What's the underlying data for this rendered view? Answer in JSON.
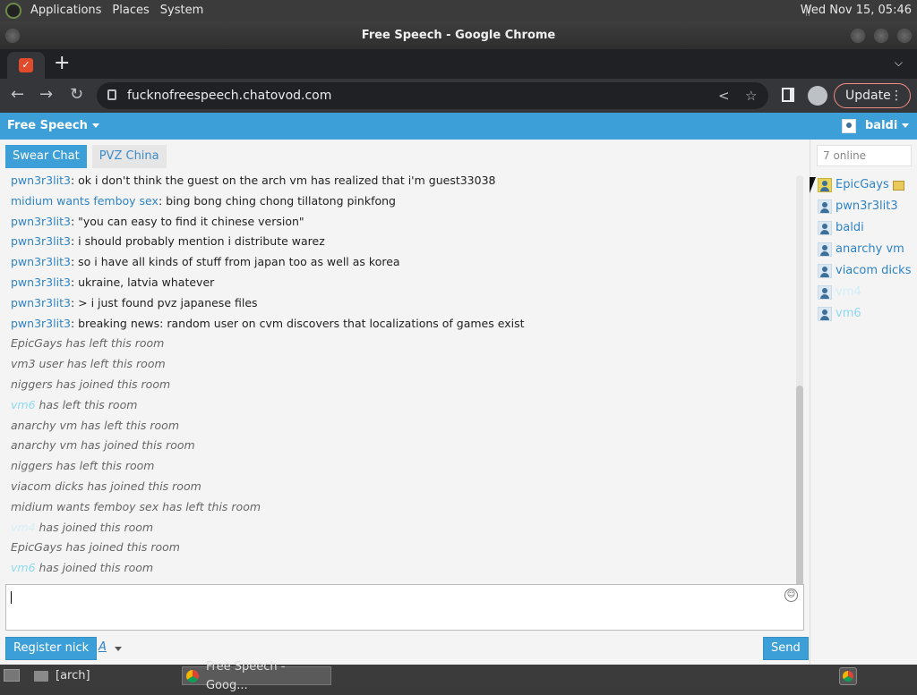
{
  "top_panel": {
    "menus": [
      "Applications",
      "Places",
      "System"
    ],
    "clock": "Wed Nov 15, 05:46"
  },
  "window": {
    "title": "Free Speech - Google Chrome"
  },
  "browser": {
    "url": "fucknofreespeech.chatovod.com",
    "update_label": "Update",
    "new_tab_label": "+"
  },
  "site": {
    "brand": "Free Speech",
    "username": "baldi",
    "room_tabs": [
      {
        "label": "Swear Chat",
        "active": true
      },
      {
        "label": "PVZ China",
        "active": false
      }
    ],
    "online_count": "7 online",
    "register_label": "Register nick",
    "font_label": "A",
    "send_label": "Send"
  },
  "messages": [
    {
      "type": "chat",
      "nick": "pwn3r3lit3",
      "text": ": ok i don't think the guest on the arch vm has realized that i'm guest33038"
    },
    {
      "type": "chat",
      "nick": "midium wants femboy sex",
      "text": ": bing bong ching chong tillatong pinkfong"
    },
    {
      "type": "chat",
      "nick": "pwn3r3lit3",
      "text": ": \"you can easy to find it chinese version\""
    },
    {
      "type": "chat",
      "nick": "pwn3r3lit3",
      "text": ": i should probably mention i distribute warez"
    },
    {
      "type": "chat",
      "nick": "pwn3r3lit3",
      "text": ": so i have all kinds of stuff from japan too as well as korea"
    },
    {
      "type": "chat",
      "nick": "pwn3r3lit3",
      "text": ": ukraine, latvia whatever"
    },
    {
      "type": "chat",
      "nick": "pwn3r3lit3",
      "text": ": > i just found pvz japanese files"
    },
    {
      "type": "chat",
      "nick": "pwn3r3lit3",
      "text": ": breaking news: random user on cvm discovers that localizations of games exist"
    },
    {
      "type": "event",
      "nick": "EpicGays",
      "text": " has left this room"
    },
    {
      "type": "event",
      "nick": "vm3 user",
      "text": " has left this room"
    },
    {
      "type": "event",
      "nick": "niggers",
      "text": " has joined this room"
    },
    {
      "type": "event-faint",
      "nick": "vm6",
      "text": " has left this room"
    },
    {
      "type": "event",
      "nick": "anarchy vm",
      "text": " has left this room"
    },
    {
      "type": "event",
      "nick": "anarchy vm",
      "text": " has joined this room"
    },
    {
      "type": "event",
      "nick": "niggers",
      "text": " has left this room"
    },
    {
      "type": "event",
      "nick": "viacom dicks",
      "text": " has joined this room"
    },
    {
      "type": "event",
      "nick": "midium wants femboy sex",
      "text": " has left this room"
    },
    {
      "type": "event-light",
      "nick": "vm4",
      "text": " has joined this room"
    },
    {
      "type": "event",
      "nick": "EpicGays",
      "text": " has joined this room"
    },
    {
      "type": "event-faint",
      "nick": "vm6",
      "text": " has joined this room"
    }
  ],
  "users": [
    {
      "name": "EpicGays",
      "style": "admin"
    },
    {
      "name": "pwn3r3lit3",
      "style": "normal"
    },
    {
      "name": "baldi",
      "style": "normal"
    },
    {
      "name": "anarchy vm",
      "style": "normal"
    },
    {
      "name": "viacom dicks",
      "style": "normal"
    },
    {
      "name": "vm4",
      "style": "light"
    },
    {
      "name": "vm6",
      "style": "faint"
    }
  ],
  "taskbar": {
    "items": [
      {
        "label": "[arch]",
        "active": false
      },
      {
        "label": "Free Speech - Goog...",
        "active": true
      }
    ]
  },
  "colors": {
    "accent": "#3d9fd7",
    "nick": "#2f83c5",
    "faint_nick": "#8fd9f0"
  }
}
